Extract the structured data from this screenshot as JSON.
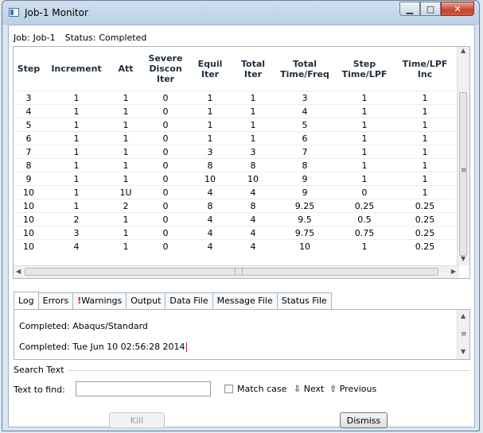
{
  "window": {
    "title": "Job-1 Monitor",
    "controls": [
      "minimize",
      "maximize",
      "close"
    ]
  },
  "job": {
    "label": "Job:",
    "name": "Job-1",
    "status_label": "Status:",
    "status": "Completed"
  },
  "table": {
    "columns": [
      "Step",
      "Increment",
      "Att",
      "Severe\nDiscon\nIter",
      "Equil\nIter",
      "Total\nIter",
      "Total\nTime/Freq",
      "Step\nTime/LPF",
      "Time/LPF\nInc"
    ],
    "rows": [
      [
        "3",
        "1",
        "1",
        "0",
        "1",
        "1",
        "3",
        "1",
        "1"
      ],
      [
        "4",
        "1",
        "1",
        "0",
        "1",
        "1",
        "4",
        "1",
        "1"
      ],
      [
        "5",
        "1",
        "1",
        "0",
        "1",
        "1",
        "5",
        "1",
        "1"
      ],
      [
        "6",
        "1",
        "1",
        "0",
        "1",
        "1",
        "6",
        "1",
        "1"
      ],
      [
        "7",
        "1",
        "1",
        "0",
        "3",
        "3",
        "7",
        "1",
        "1"
      ],
      [
        "8",
        "1",
        "1",
        "0",
        "8",
        "8",
        "8",
        "1",
        "1"
      ],
      [
        "9",
        "1",
        "1",
        "0",
        "10",
        "10",
        "9",
        "1",
        "1"
      ],
      [
        "10",
        "1",
        "1U",
        "0",
        "4",
        "4",
        "9",
        "0",
        "1"
      ],
      [
        "10",
        "1",
        "2",
        "0",
        "8",
        "8",
        "9.25",
        "0.25",
        "0.25"
      ],
      [
        "10",
        "2",
        "1",
        "0",
        "4",
        "4",
        "9.5",
        "0.5",
        "0.25"
      ],
      [
        "10",
        "3",
        "1",
        "0",
        "4",
        "4",
        "9.75",
        "0.75",
        "0.25"
      ],
      [
        "10",
        "4",
        "1",
        "0",
        "4",
        "4",
        "10",
        "1",
        "0.25"
      ]
    ]
  },
  "tabs": [
    "Log",
    "Errors",
    "Warnings",
    "Output",
    "Data File",
    "Message File",
    "Status File"
  ],
  "active_tab": "Log",
  "log": [
    "Completed: Abaqus/Standard",
    "Completed: Tue Jun 10 02:56:28 2014"
  ],
  "search": {
    "title": "Search Text",
    "find_label": "Text to find:",
    "find_value": "",
    "match_case": "Match case",
    "next": "Next",
    "previous": "Previous"
  },
  "buttons": {
    "kill": "Kill",
    "dismiss": "Dismiss"
  },
  "colors": {
    "warning": "#d01818",
    "title_gradient_top": "#cfdeee"
  }
}
